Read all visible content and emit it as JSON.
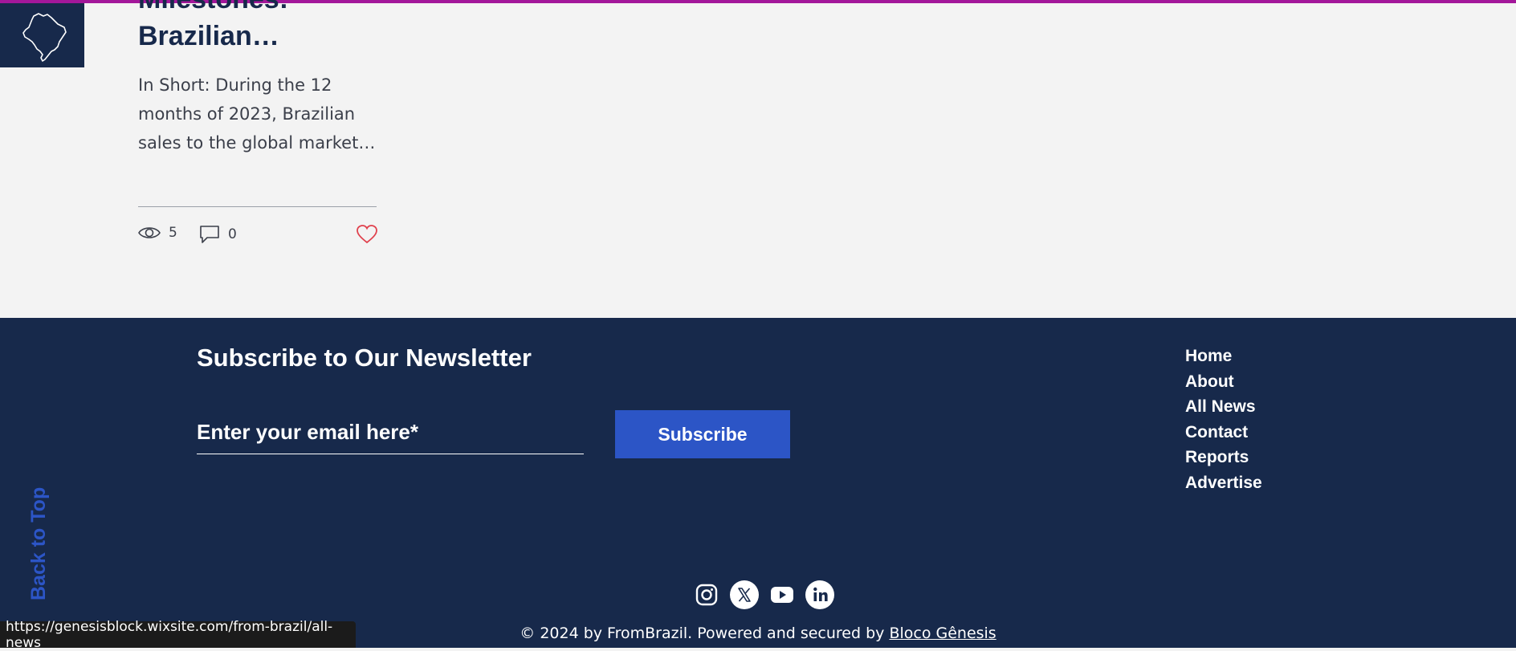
{
  "post": {
    "title": "Milestones: Brazilian…",
    "excerpt": "In Short: During the 12 months of 2023, Brazilian sales to the global market…",
    "views": "5",
    "comments": "0"
  },
  "footer": {
    "newsletter_title": "Subscribe to Our Newsletter",
    "email_placeholder": "Enter your email here*",
    "subscribe_label": "Subscribe",
    "back_to_top": "Back to Top",
    "nav": [
      "Home",
      "About",
      "All News",
      "Contact",
      "Reports",
      "Advertise"
    ],
    "social_icons": [
      "instagram-icon",
      "x-icon",
      "youtube-icon",
      "linkedin-icon"
    ],
    "copyright_text": "© 2024 by FromBrazil. Powered and secured by ",
    "copyright_link": "Bloco Gênesis"
  },
  "status_bar": {
    "url": "https://genesisblock.wixsite.com/from-brazil/all-news"
  },
  "colors": {
    "accent_bar": "#a3179a",
    "footer_bg": "#17294b",
    "button_blue": "#2c55c6",
    "like_red": "#e0414d"
  }
}
